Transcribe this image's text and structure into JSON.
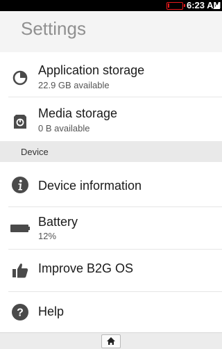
{
  "status_bar": {
    "time": "6:23 AM",
    "battery_level": 0.12
  },
  "header": {
    "title": "Settings"
  },
  "items": [
    {
      "label": "Application storage",
      "sublabel": "22.9 GB available",
      "icon": "pie-chart-icon"
    },
    {
      "label": "Media storage",
      "sublabel": "0 B available",
      "icon": "sd-card-icon"
    }
  ],
  "section": {
    "title": "Device"
  },
  "device_items": [
    {
      "label": "Device information",
      "icon": "info-icon"
    },
    {
      "label": "Battery",
      "sublabel": "12%",
      "icon": "battery-icon"
    },
    {
      "label": "Improve B2G OS",
      "icon": "thumbs-up-icon"
    },
    {
      "label": "Help",
      "icon": "help-icon"
    }
  ],
  "bottom_bar": {
    "icon": "home-icon"
  },
  "colors": {
    "accent_red": "#e8191c",
    "icon_gray": "#4a4a4a",
    "header_bg": "#f4f4f4"
  }
}
